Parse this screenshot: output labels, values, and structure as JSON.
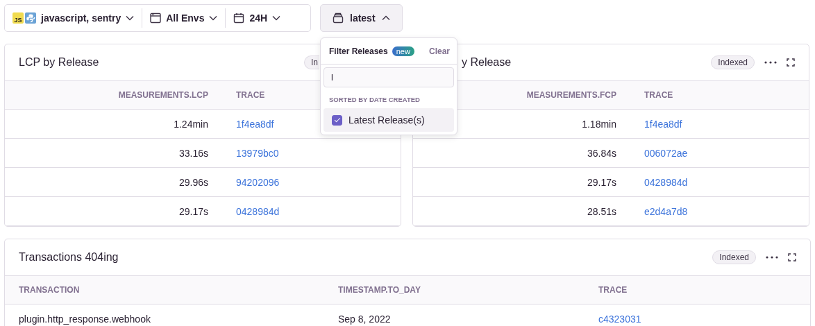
{
  "filters": {
    "platform_badge": "JS",
    "project": "javascript, sentry",
    "environment": "All Envs",
    "period": "24H"
  },
  "release_button": {
    "label": "latest",
    "expanded": true
  },
  "release_menu": {
    "title": "Filter Releases",
    "badge": "new",
    "clear": "Clear",
    "search": {
      "value": "l"
    },
    "section": "SORTED BY DATE CREATED",
    "options": [
      {
        "label": "Latest Release(s)",
        "checked": true
      }
    ]
  },
  "widgets": [
    {
      "title": "LCP by Release",
      "title_cut": false,
      "badge": "In",
      "badge_cut": true,
      "actions_visible": false,
      "columns": [
        {
          "label": "MEASUREMENTS.LCP",
          "kind": "number"
        },
        {
          "label": "TRACE",
          "kind": "link"
        }
      ],
      "rows": [
        [
          "1.24min",
          "1f4ea8df"
        ],
        [
          "33.16s",
          "13979bc0"
        ],
        [
          "29.96s",
          "94202096"
        ],
        [
          "29.17s",
          "0428984d"
        ]
      ]
    },
    {
      "title": "y Release",
      "title_cut": true,
      "badge": "Indexed",
      "badge_cut": false,
      "actions_visible": true,
      "columns": [
        {
          "label": "MEASUREMENTS.FCP",
          "kind": "number"
        },
        {
          "label": "TRACE",
          "kind": "link"
        }
      ],
      "rows": [
        [
          "1.18min",
          "1f4ea8df"
        ],
        [
          "36.84s",
          "006072ae"
        ],
        [
          "29.17s",
          "0428984d"
        ],
        [
          "28.51s",
          "e2d4a7d8"
        ]
      ]
    },
    {
      "title": "Transactions 404ing",
      "title_cut": false,
      "badge": "Indexed",
      "badge_cut": false,
      "actions_visible": true,
      "columns": [
        {
          "label": "TRANSACTION",
          "kind": "text"
        },
        {
          "label": "TIMESTAMP.TO_DAY",
          "kind": "text"
        },
        {
          "label": "TRACE",
          "kind": "link"
        }
      ],
      "rows": [
        [
          "plugin.http_response.webhook",
          "Sep 8, 2022",
          "c4323031"
        ]
      ]
    }
  ]
}
